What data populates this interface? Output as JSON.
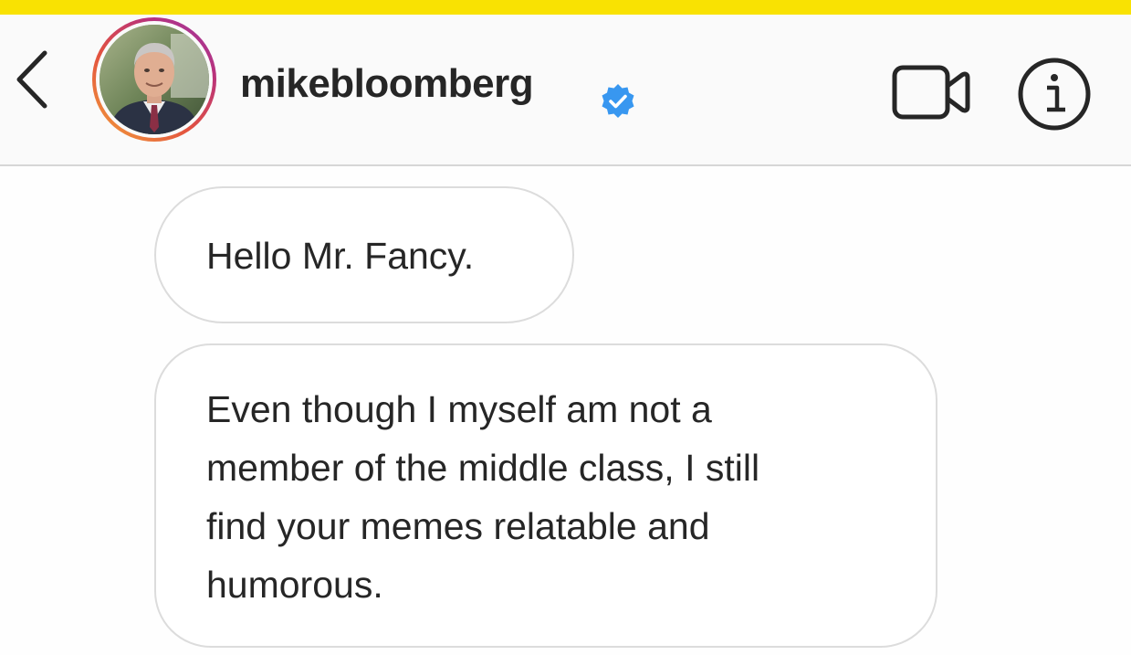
{
  "header": {
    "back_icon": "chevron-left-icon",
    "username": "mikebloomberg",
    "verified_icon": "verified-badge-icon",
    "video_icon": "video-call-icon",
    "info_icon": "info-icon",
    "verified_color": "#3897f0",
    "story_ring_colors": [
      "#f3a23a",
      "#e3533f",
      "#b8327c",
      "#9b3aa8"
    ]
  },
  "messages": [
    {
      "text": "Hello Mr. Fancy."
    },
    {
      "lines": [
        "Even though I myself am not a",
        "member of the middle class, I still",
        "find your memes relatable and",
        "humorous."
      ]
    }
  ],
  "colors": {
    "top_bar": "#f9e202",
    "header_bg": "#fafafa",
    "text": "#262626",
    "bubble_border": "#dcdcdc"
  }
}
